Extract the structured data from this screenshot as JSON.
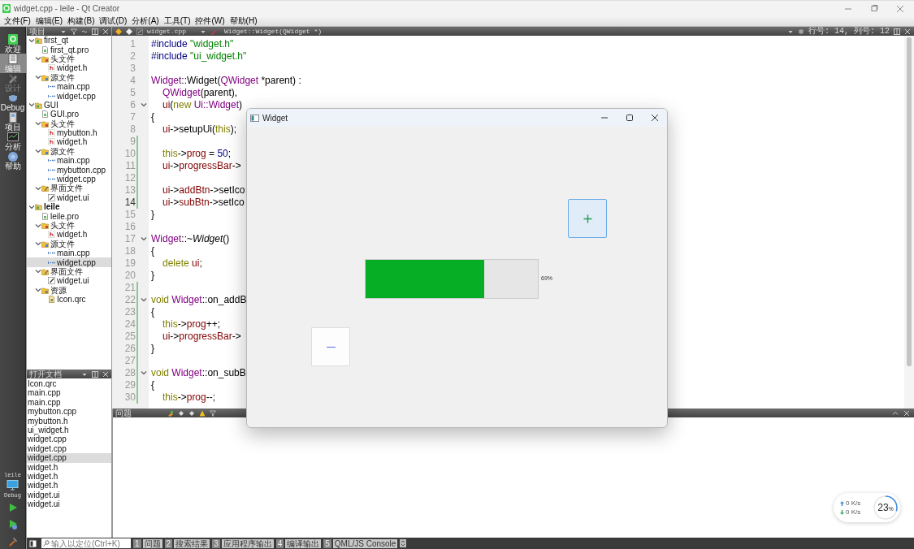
{
  "window": {
    "title": "widget.cpp - leile - Qt Creator"
  },
  "menu": [
    "文件(F)",
    "编辑(E)",
    "构建(B)",
    "调试(D)",
    "分析(A)",
    "工具(T)",
    "控件(W)",
    "帮助(H)"
  ],
  "mode_bar": {
    "items": [
      {
        "label": "欢迎",
        "kind": "welcome",
        "selected": false,
        "disabled": false
      },
      {
        "label": "编辑",
        "kind": "edit",
        "selected": true,
        "disabled": false
      },
      {
        "label": "设计",
        "kind": "design",
        "selected": false,
        "disabled": true
      },
      {
        "label": "Debug",
        "kind": "debug",
        "selected": false,
        "disabled": false
      },
      {
        "label": "项目",
        "kind": "projects",
        "selected": false,
        "disabled": false
      },
      {
        "label": "分析",
        "kind": "analyze",
        "selected": false,
        "disabled": false
      },
      {
        "label": "帮助",
        "kind": "help",
        "selected": false,
        "disabled": false
      }
    ],
    "kit": {
      "project": "leile",
      "build": "Debug"
    }
  },
  "projects_panel": {
    "title": "项目",
    "tree": [
      {
        "label": "first_qt",
        "kind": "project",
        "active": false,
        "expanded": true,
        "selected": false,
        "children": [
          {
            "label": "first_qt.pro",
            "kind": "pro",
            "selected": false
          },
          {
            "label": "头文件",
            "kind": "headers",
            "expanded": true,
            "selected": false,
            "children": [
              {
                "label": "widget.h",
                "kind": "h",
                "selected": false
              }
            ]
          },
          {
            "label": "源文件",
            "kind": "sources",
            "expanded": true,
            "selected": false,
            "children": [
              {
                "label": "main.cpp",
                "kind": "cpp",
                "selected": false
              },
              {
                "label": "widget.cpp",
                "kind": "cpp",
                "selected": false
              }
            ]
          }
        ]
      },
      {
        "label": "GUI",
        "kind": "project",
        "active": false,
        "expanded": true,
        "selected": false,
        "children": [
          {
            "label": "GUI.pro",
            "kind": "pro",
            "selected": false
          },
          {
            "label": "头文件",
            "kind": "headers",
            "expanded": true,
            "selected": false,
            "children": [
              {
                "label": "mybutton.h",
                "kind": "h",
                "selected": false
              },
              {
                "label": "widget.h",
                "kind": "h",
                "selected": false
              }
            ]
          },
          {
            "label": "源文件",
            "kind": "sources",
            "expanded": true,
            "selected": false,
            "children": [
              {
                "label": "main.cpp",
                "kind": "cpp",
                "selected": false
              },
              {
                "label": "mybutton.cpp",
                "kind": "cpp",
                "selected": false
              },
              {
                "label": "widget.cpp",
                "kind": "cpp",
                "selected": false
              }
            ]
          },
          {
            "label": "界面文件",
            "kind": "forms",
            "expanded": true,
            "selected": false,
            "children": [
              {
                "label": "widget.ui",
                "kind": "ui",
                "selected": false
              }
            ]
          }
        ]
      },
      {
        "label": "leile",
        "kind": "project",
        "active": true,
        "expanded": true,
        "selected": false,
        "children": [
          {
            "label": "leile.pro",
            "kind": "pro",
            "selected": false
          },
          {
            "label": "头文件",
            "kind": "headers",
            "expanded": true,
            "selected": false,
            "children": [
              {
                "label": "widget.h",
                "kind": "h",
                "selected": false
              }
            ]
          },
          {
            "label": "源文件",
            "kind": "sources",
            "expanded": true,
            "selected": false,
            "children": [
              {
                "label": "main.cpp",
                "kind": "cpp",
                "selected": false
              },
              {
                "label": "widget.cpp",
                "kind": "cpp",
                "selected": true
              }
            ]
          },
          {
            "label": "界面文件",
            "kind": "forms",
            "expanded": true,
            "selected": false,
            "children": [
              {
                "label": "widget.ui",
                "kind": "ui",
                "selected": false
              }
            ]
          },
          {
            "label": "资源",
            "kind": "resources",
            "expanded": true,
            "selected": false,
            "children": [
              {
                "label": "Icon.qrc",
                "kind": "qrc",
                "selected": false
              }
            ]
          }
        ]
      }
    ]
  },
  "open_documents": {
    "title": "打开文档",
    "items": [
      {
        "label": "Icon.qrc",
        "selected": false
      },
      {
        "label": "main.cpp",
        "selected": false
      },
      {
        "label": "main.cpp",
        "selected": false
      },
      {
        "label": "mybutton.cpp",
        "selected": false
      },
      {
        "label": "mybutton.h",
        "selected": false
      },
      {
        "label": "ui_widget.h",
        "selected": false
      },
      {
        "label": "widget.cpp",
        "selected": false
      },
      {
        "label": "widget.cpp",
        "selected": false
      },
      {
        "label": "widget.cpp",
        "selected": true
      },
      {
        "label": "widget.h",
        "selected": false
      },
      {
        "label": "widget.h",
        "selected": false
      },
      {
        "label": "widget.h",
        "selected": false
      },
      {
        "label": "widget.ui",
        "selected": false
      },
      {
        "label": "widget.ui",
        "selected": false
      }
    ]
  },
  "editor": {
    "file": "widget.cpp",
    "symbol": "Widget::Widget(QWidget *)",
    "position": "行号: 14, 列号: 12",
    "lines": [
      {
        "number": "1",
        "current": false,
        "fold": false,
        "changed": false,
        "indent": false,
        "tokens": [
          {
            "text": "#include ",
            "kind": "pre"
          },
          {
            "text": "\"widget.h\"",
            "kind": "str"
          }
        ]
      },
      {
        "number": "2",
        "current": false,
        "fold": false,
        "changed": false,
        "indent": false,
        "tokens": [
          {
            "text": "#include ",
            "kind": "pre"
          },
          {
            "text": "\"ui_widget.h\"",
            "kind": "str"
          }
        ]
      },
      {
        "number": "3",
        "current": false,
        "fold": false,
        "changed": false
      },
      {
        "number": "4",
        "current": false,
        "fold": false,
        "changed": false,
        "indent": false,
        "tokens": [
          {
            "text": "Widget",
            "kind": "type"
          },
          {
            "text": "::Widget(",
            "kind": "plain"
          },
          {
            "text": "QWidget",
            "kind": "type"
          },
          {
            "text": " *parent) :",
            "kind": "plain"
          }
        ]
      },
      {
        "number": "5",
        "current": false,
        "fold": false,
        "changed": false,
        "indent": true,
        "tokens": [
          {
            "text": "QWidget",
            "kind": "type"
          },
          {
            "text": "(parent),",
            "kind": "plain"
          }
        ]
      },
      {
        "number": "6",
        "current": false,
        "fold": true,
        "changed": false,
        "indent": true,
        "tokens": [
          {
            "text": "ui",
            "kind": "field"
          },
          {
            "text": "(",
            "kind": "plain"
          },
          {
            "text": "new ",
            "kind": "kw"
          },
          {
            "text": "Ui::Widget",
            "kind": "type"
          },
          {
            "text": ")",
            "kind": "plain"
          }
        ]
      },
      {
        "number": "7",
        "current": false,
        "fold": false,
        "changed": false,
        "indent": false,
        "tokens": [
          {
            "text": "{",
            "kind": "plain"
          }
        ]
      },
      {
        "number": "8",
        "current": false,
        "fold": false,
        "changed": false,
        "indent": true,
        "tokens": [
          {
            "text": "ui",
            "kind": "field"
          },
          {
            "text": "->setupUi(",
            "kind": "plain"
          },
          {
            "text": "this",
            "kind": "kw"
          },
          {
            "text": ");",
            "kind": "plain"
          }
        ]
      },
      {
        "number": "9",
        "current": false,
        "fold": false,
        "changed": true
      },
      {
        "number": "10",
        "current": false,
        "fold": false,
        "changed": true,
        "indent": true,
        "tokens": [
          {
            "text": "this",
            "kind": "kw"
          },
          {
            "text": "->",
            "kind": "plain"
          },
          {
            "text": "prog",
            "kind": "field"
          },
          {
            "text": " = ",
            "kind": "plain"
          },
          {
            "text": "50",
            "kind": "num"
          },
          {
            "text": ";",
            "kind": "plain"
          }
        ]
      },
      {
        "number": "11",
        "current": false,
        "fold": false,
        "changed": true,
        "indent": true,
        "tokens": [
          {
            "text": "ui",
            "kind": "field"
          },
          {
            "text": "->",
            "kind": "plain"
          },
          {
            "text": "progressBar",
            "kind": "field"
          },
          {
            "text": "->",
            "kind": "plain"
          }
        ]
      },
      {
        "number": "12",
        "current": false,
        "fold": false,
        "changed": true
      },
      {
        "number": "13",
        "current": false,
        "fold": false,
        "changed": true,
        "indent": true,
        "tokens": [
          {
            "text": "ui",
            "kind": "field"
          },
          {
            "text": "->",
            "kind": "plain"
          },
          {
            "text": "addBtn",
            "kind": "field"
          },
          {
            "text": "->setIco",
            "kind": "plain"
          }
        ]
      },
      {
        "number": "14",
        "current": true,
        "fold": false,
        "changed": true,
        "indent": true,
        "tokens": [
          {
            "text": "ui",
            "kind": "field"
          },
          {
            "text": "->",
            "kind": "plain"
          },
          {
            "text": "subBtn",
            "kind": "field"
          },
          {
            "text": "->setIco",
            "kind": "plain"
          }
        ]
      },
      {
        "number": "15",
        "current": false,
        "fold": false,
        "changed": false,
        "indent": false,
        "tokens": [
          {
            "text": "}",
            "kind": "plain"
          }
        ]
      },
      {
        "number": "16",
        "current": false,
        "fold": false,
        "changed": false
      },
      {
        "number": "17",
        "current": false,
        "fold": true,
        "changed": false,
        "indent": false,
        "tokens": [
          {
            "text": "Widget",
            "kind": "type"
          },
          {
            "text": "::~",
            "kind": "plain"
          },
          {
            "text": "Widget",
            "kind": "decl"
          },
          {
            "text": "()",
            "kind": "plain"
          }
        ]
      },
      {
        "number": "18",
        "current": false,
        "fold": false,
        "changed": false,
        "indent": false,
        "tokens": [
          {
            "text": "{",
            "kind": "plain"
          }
        ]
      },
      {
        "number": "19",
        "current": false,
        "fold": false,
        "changed": false,
        "indent": true,
        "tokens": [
          {
            "text": "delete ",
            "kind": "kw"
          },
          {
            "text": "ui",
            "kind": "field"
          },
          {
            "text": ";",
            "kind": "plain"
          }
        ]
      },
      {
        "number": "20",
        "current": false,
        "fold": false,
        "changed": false,
        "indent": false,
        "tokens": [
          {
            "text": "}",
            "kind": "plain"
          }
        ]
      },
      {
        "number": "21",
        "current": false,
        "fold": false,
        "changed": true
      },
      {
        "number": "22",
        "current": false,
        "fold": true,
        "changed": true,
        "indent": false,
        "tokens": [
          {
            "text": "void ",
            "kind": "kw"
          },
          {
            "text": "Widget",
            "kind": "type"
          },
          {
            "text": "::on_addB",
            "kind": "plain"
          }
        ]
      },
      {
        "number": "23",
        "current": false,
        "fold": false,
        "changed": true,
        "indent": false,
        "tokens": [
          {
            "text": "{",
            "kind": "plain"
          }
        ]
      },
      {
        "number": "24",
        "current": false,
        "fold": false,
        "changed": true,
        "indent": true,
        "tokens": [
          {
            "text": "this",
            "kind": "kw"
          },
          {
            "text": "->",
            "kind": "plain"
          },
          {
            "text": "prog",
            "kind": "field"
          },
          {
            "text": "++;",
            "kind": "plain"
          }
        ]
      },
      {
        "number": "25",
        "current": false,
        "fold": false,
        "changed": true,
        "indent": true,
        "tokens": [
          {
            "text": "ui",
            "kind": "field"
          },
          {
            "text": "->",
            "kind": "plain"
          },
          {
            "text": "progressBar",
            "kind": "field"
          },
          {
            "text": "->",
            "kind": "plain"
          }
        ]
      },
      {
        "number": "26",
        "current": false,
        "fold": false,
        "changed": true,
        "indent": false,
        "tokens": [
          {
            "text": "}",
            "kind": "plain"
          }
        ]
      },
      {
        "number": "27",
        "current": false,
        "fold": false,
        "changed": true
      },
      {
        "number": "28",
        "current": false,
        "fold": true,
        "changed": true,
        "indent": false,
        "tokens": [
          {
            "text": "void ",
            "kind": "kw"
          },
          {
            "text": "Widget",
            "kind": "type"
          },
          {
            "text": "::on_subB",
            "kind": "plain"
          }
        ]
      },
      {
        "number": "29",
        "current": false,
        "fold": false,
        "changed": true,
        "indent": false,
        "tokens": [
          {
            "text": "{",
            "kind": "plain"
          }
        ]
      },
      {
        "number": "30",
        "current": false,
        "fold": false,
        "changed": true,
        "indent": true,
        "tokens": [
          {
            "text": "this",
            "kind": "kw"
          },
          {
            "text": "->",
            "kind": "plain"
          },
          {
            "text": "prog",
            "kind": "field"
          },
          {
            "text": "--;",
            "kind": "plain"
          }
        ]
      }
    ]
  },
  "issues_panel": {
    "title": "问题"
  },
  "status_bar": {
    "search": {
      "placeholder": "输入以定位(Ctrl+K)"
    },
    "tabs": [
      {
        "number": "1",
        "label": "问题"
      },
      {
        "number": "2",
        "label": "搜索结果"
      },
      {
        "number": "3",
        "label": "应用程序输出"
      },
      {
        "number": "4",
        "label": "编译输出"
      },
      {
        "number": "5",
        "label": "QML/JS Console"
      }
    ]
  },
  "app_window": {
    "title": "Widget",
    "progress": {
      "level": 0.69,
      "reading": "69%"
    }
  },
  "net_monitor": {
    "upload": "0 K/s",
    "download": "0 K/s",
    "load": {
      "value": "23",
      "unit": "%"
    }
  }
}
